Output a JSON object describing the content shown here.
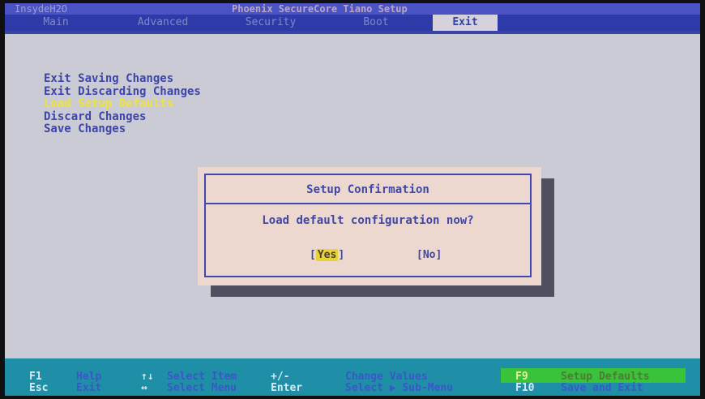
{
  "header": {
    "version": "InsydeH2O",
    "title": "Phoenix SecureCore Tiano Setup"
  },
  "tabs": [
    {
      "label": "Main",
      "active": false
    },
    {
      "label": "Advanced",
      "active": false
    },
    {
      "label": "Security",
      "active": false
    },
    {
      "label": "Boot",
      "active": false
    },
    {
      "label": "Exit",
      "active": true
    }
  ],
  "menu": {
    "items": [
      {
        "label": "Exit Saving Changes",
        "selected": false
      },
      {
        "label": "Exit Discarding Changes",
        "selected": false
      },
      {
        "label": "Load Setup Defaults",
        "selected": true
      },
      {
        "label": "Discard Changes",
        "selected": false
      },
      {
        "label": "Save Changes",
        "selected": false
      }
    ]
  },
  "dialog": {
    "title": "Setup Confirmation",
    "message": "Load default configuration now?",
    "yes_label": "Yes",
    "no_label": "[No]"
  },
  "footer": {
    "row1": [
      {
        "key": "F1",
        "desc": "Help"
      },
      {
        "key": "↑↓",
        "desc": "Select Item"
      },
      {
        "key": "+/-",
        "desc": "Change Values"
      },
      {
        "key": "F9",
        "desc": "Setup Defaults"
      }
    ],
    "row2": [
      {
        "key": "Esc",
        "desc": "Exit"
      },
      {
        "key": "↔",
        "desc": "Select Menu"
      },
      {
        "key": "Enter",
        "desc": "Select ▶ Sub-Menu"
      },
      {
        "key": "F10",
        "desc": "Save and Exit"
      }
    ]
  },
  "colors": {
    "accent": "#2e3aa8",
    "highlight": "#efe23a",
    "footer": "#1f8fa8"
  }
}
